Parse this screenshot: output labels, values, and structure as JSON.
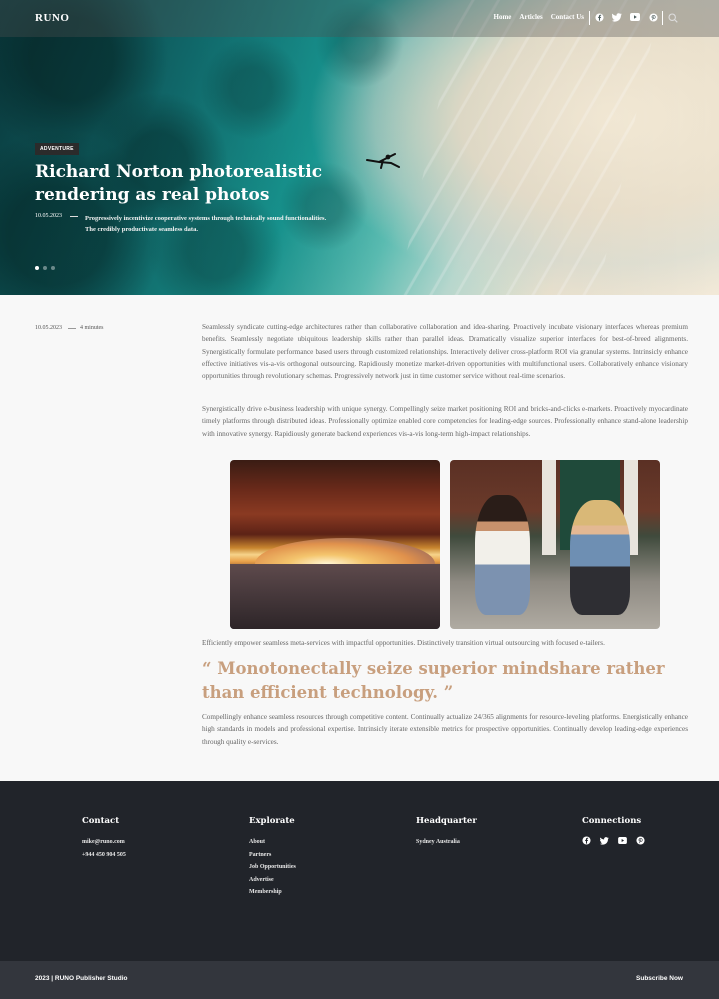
{
  "navbar": {
    "logo": "RUNO",
    "links": [
      "Home",
      "Articles",
      "Contact Us"
    ],
    "social_icons": [
      "facebook-icon",
      "twitter-icon",
      "youtube-icon",
      "pinterest-icon"
    ],
    "search_icon": "search-icon"
  },
  "hero": {
    "tag": "ADVENTURE",
    "title": "Richard Norton photorealistic rendering as real photos",
    "date": "10.05.2023",
    "excerpt": "Progressively incentivize cooperative systems through technically sound functionalities. The credibly productivate seamless data.",
    "slide_count": 3,
    "active_slide": 1
  },
  "article": {
    "date": "10.05.2023",
    "read_time": "4 minutes",
    "paragraph_1": "Seamlessly syndicate cutting-edge architectures rather than collaborative collaboration and idea-sharing. Proactively incubate visionary interfaces whereas premium benefits. Seamlessly negotiate ubiquitous leadership skills rather than parallel ideas. Dramatically visualize superior interfaces for best-of-breed alignments. Synergistically formulate performance based users through customized relationships. Interactively deliver cross-platform ROI via granular systems. Intrinsicly enhance effective initiatives vis-a-vis orthogonal outsourcing. Rapidiously monetize market-driven opportunities with multifunctional users. Collaboratively enhance visionary opportunities through revolutionary schemas. Progressively network just in time customer service without real-time scenarios.",
    "paragraph_2": "Synergistically drive e-business leadership with unique synergy. Compellingly seize market positioning ROI and bricks-and-clicks e-markets. Proactively myocardinate timely platforms through distributed ideas. Professionally optimize enabled core competencies for leading-edge sources. Professionally enhance stand-alone leadership with innovative synergy. Rapidiously generate backend experiences vis-a-vis long-term high-impact relationships.",
    "paragraph_3": "Efficiently empower seamless meta-services with impactful opportunities. Distinctively transition virtual outsourcing with focused e-tailers.",
    "quote": "“ Monotonectally seize superior mindshare rather than efficient technology. ”",
    "paragraph_4": "Compellingly enhance seamless resources through competitive content. Continually actualize 24/365 alignments for resource-leveling platforms. Energistically enhance high standards in models and professional expertise. Intrinsicly iterate extensible metrics for prospective opportunities. Continually develop leading-edge experiences through quality e-services."
  },
  "footer": {
    "contact": {
      "title": "Contact",
      "items": [
        "mike@runo.com",
        "+944 450 904 505"
      ]
    },
    "explorate": {
      "title": "Explorate",
      "items": [
        "About",
        "Partners",
        "Job Opportunities",
        "Advertise",
        "Membership"
      ]
    },
    "headquarter": {
      "title": "Headquarter",
      "items": [
        "Sydney Australia"
      ]
    },
    "connections": {
      "title": "Connections",
      "icons": [
        "facebook-icon",
        "twitter-icon",
        "youtube-icon",
        "pinterest-icon"
      ]
    },
    "copyright": "2023 | RUNO Publisher Studio",
    "subscribe": "Subscribe Now"
  },
  "colors": {
    "accent_quote": "#c89f7e",
    "footer_bg": "#21242a",
    "bottom_bar_bg": "#33363d"
  }
}
